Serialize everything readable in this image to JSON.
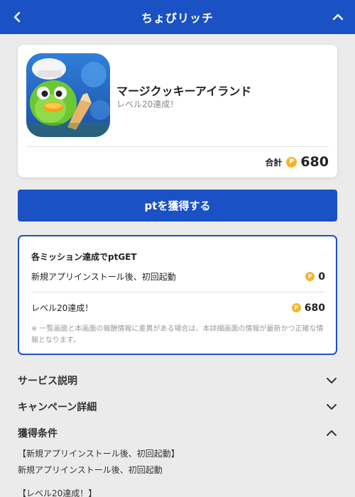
{
  "header": {
    "title": "ちょびリッチ",
    "back_icon": "chevron-left-icon",
    "collapse_icon": "chevron-up-icon"
  },
  "app": {
    "name": "マージクッキーアイランド",
    "subtitle": "レベル20達成！",
    "total_label": "合計",
    "coin_symbol": "P",
    "total_points": "680"
  },
  "get_button_label": "ptを獲得する",
  "missions": {
    "title": "各ミッション達成でptGET",
    "items": [
      {
        "label": "新規アプリインストール後、初回起動",
        "points": "0"
      },
      {
        "label": "レベル20達成！",
        "points": "680"
      }
    ],
    "note": "※ 一覧画面と本画面の報酬情報に差異がある場合は、本詳細画面の情報が最新かつ正確な情報となります。"
  },
  "accordion": [
    {
      "label": "サービス説明",
      "state": "collapsed",
      "icon": "chevron-down-icon"
    },
    {
      "label": "キャンペーン詳細",
      "state": "collapsed",
      "icon": "chevron-down-icon"
    },
    {
      "label": "獲得条件",
      "state": "expanded",
      "icon": "chevron-up-icon"
    }
  ],
  "conditions": [
    "【新規アプリインストール後、初回起動】",
    "新規アプリインストール後、初回起動",
    "【レベル20達成！】"
  ],
  "colors": {
    "brand_blue": "#1a52c6",
    "coin_gold": "#f2b52c",
    "background": "#ebebeb"
  }
}
